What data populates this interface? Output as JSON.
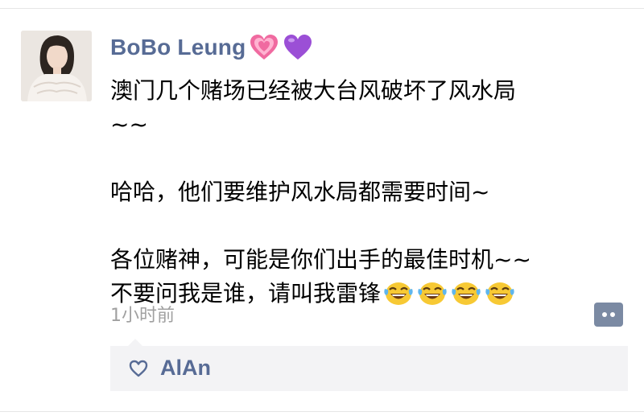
{
  "post": {
    "username": "BoBo Leung",
    "name_icons": [
      "pink-heart-icon",
      "purple-heart-icon"
    ],
    "lines": [
      "澳门几个赌场已经被大台风破坏了风水局",
      "~~",
      "",
      "哈哈，他们要维护风水局都需要时间~",
      "",
      "各位赌神，可能是你们出手的最佳时机~~",
      "不要问我是谁，请叫我雷锋"
    ],
    "trailing_emojis": [
      "laughing-tears-emoji",
      "laughing-tears-emoji",
      "laughing-tears-emoji",
      "laughing-tears-emoji"
    ],
    "timestamp": "1小时前"
  },
  "likes": {
    "icon": "heart-outline-icon",
    "names": [
      "AlAn"
    ]
  },
  "colors": {
    "name_link": "#576b95",
    "timestamp": "#a0a0a0",
    "likes_background": "#f3f3f5",
    "comment_button": "#7b8aa3"
  }
}
